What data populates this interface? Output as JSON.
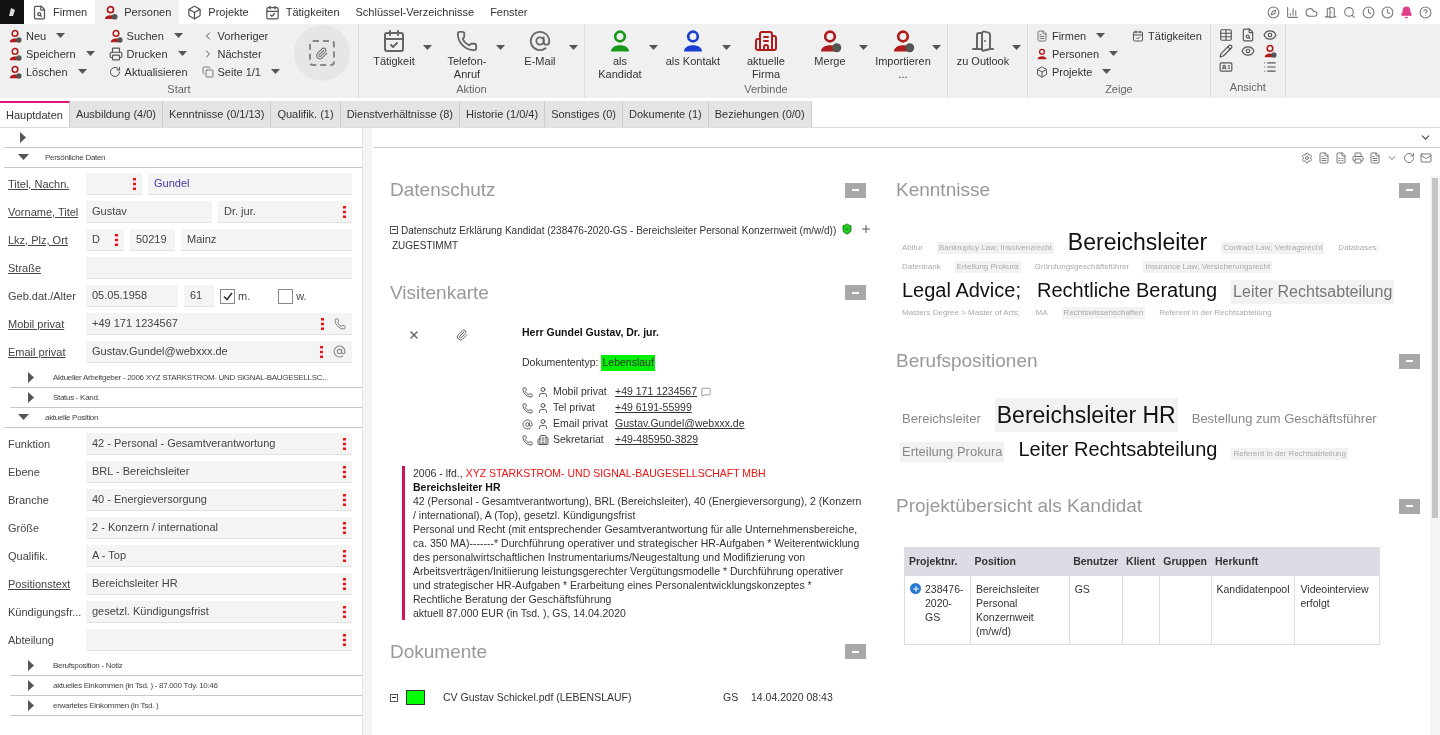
{
  "menu": [
    {
      "label": "Firmen",
      "kind": "icon",
      "selected": false
    },
    {
      "label": "Personen",
      "kind": "icon",
      "selected": true
    },
    {
      "label": "Projekte",
      "kind": "icon",
      "selected": false
    },
    {
      "label": "Tätigkeiten",
      "kind": "icon",
      "selected": false
    },
    {
      "label": "Schlüssel-Verzeichnisse",
      "kind": "plain",
      "selected": false
    },
    {
      "label": "Fenster",
      "kind": "plain",
      "selected": false
    }
  ],
  "ribbon": [
    {
      "kind": "start",
      "label": "Start",
      "columns": [
        [
          {
            "label": "Neu",
            "dropdown": true
          },
          {
            "label": "Speichern",
            "dropdown": true
          },
          {
            "label": "Löschen",
            "dropdown": true
          }
        ],
        [
          {
            "label": "Suchen",
            "dropdown": true
          },
          {
            "label": "Drucken",
            "dropdown": true
          },
          {
            "label": "Aktualisieren",
            "dropdown": false
          }
        ],
        [
          {
            "label": "Vorheriger",
            "dropdown": false
          },
          {
            "label": "Nächster",
            "dropdown": false
          },
          {
            "label": "Seite 1/1",
            "dropdown": true
          }
        ]
      ]
    },
    {
      "kind": "large",
      "label": "Aktion",
      "buttons": [
        {
          "label": "Tätigkeit",
          "dropdown": true
        },
        {
          "label": "Telefon-Anruf",
          "dropdown": true
        },
        {
          "label": "E-Mail",
          "dropdown": true
        }
      ]
    },
    {
      "kind": "large",
      "label": "Verbinde",
      "buttons": [
        {
          "label": "als Kandidat",
          "dropdown": true
        },
        {
          "label": "als Kontakt",
          "dropdown": true
        },
        {
          "label": "aktuelle Firma",
          "dropdown": false
        },
        {
          "label": "Merge",
          "dropdown": true
        },
        {
          "label": "Importieren...",
          "dropdown": true
        }
      ]
    },
    {
      "kind": "large",
      "buttons": [
        {
          "label": "zu Outlook",
          "dropdown": true
        }
      ]
    },
    {
      "kind": "small",
      "label": "Zeige",
      "columns": [
        [
          {
            "label": "Firmen",
            "dropdown": true
          },
          {
            "label": "Personen",
            "dropdown": true
          },
          {
            "label": "Projekte",
            "dropdown": true
          }
        ],
        [
          {
            "label": "Tätigkeiten",
            "dropdown": false
          }
        ]
      ]
    },
    {
      "kind": "icons",
      "label": "Ansicht"
    }
  ],
  "tabs": [
    {
      "label": "Hauptdaten",
      "selected": true
    },
    {
      "label": "Ausbildung (4/0)",
      "selected": false
    },
    {
      "label": "Kenntnisse (0/1/13)",
      "selected": false
    },
    {
      "label": "Qualifik. (1)",
      "selected": false
    },
    {
      "label": "Dienstverhältnisse (8)",
      "selected": false
    },
    {
      "label": "Historie (1/0/4)",
      "selected": false
    },
    {
      "label": "Sonstiges (0)",
      "selected": false
    },
    {
      "label": "Dokumente (1)",
      "selected": false
    },
    {
      "label": "Beziehungen (0/0)",
      "selected": false
    }
  ],
  "form": [
    {
      "expanded": false,
      "indented": false
    },
    {
      "title": "Persönliche Daten",
      "expanded": true,
      "indented": false,
      "rows": [
        {
          "label": "Titel, Nachn.",
          "link": true,
          "kind": "fields",
          "fields": [
            {
              "required": true
            },
            {
              "value": "Gundel",
              "required": false,
              "accent": true
            }
          ]
        },
        {
          "label": "Vorname, Titel",
          "link": true,
          "kind": "fields",
          "fields": [
            {
              "value": "Gustav",
              "required": false,
              "accent": false
            },
            {
              "value": "Dr. jur.",
              "required": true,
              "accent": false
            }
          ]
        },
        {
          "label": "Lkz, Plz, Ort",
          "link": true,
          "kind": "fields",
          "fields": [
            {
              "value": "D",
              "required": true,
              "accent": false
            },
            {
              "value": "50219",
              "required": false,
              "accent": false
            },
            {
              "value": "Mainz",
              "required": false,
              "accent": false
            }
          ]
        },
        {
          "label": "Straße",
          "link": true,
          "kind": "fields",
          "fields": [
            {
              "required": false
            }
          ]
        },
        {
          "label": "Geb.dat./Alter",
          "link": false,
          "kind": "birth",
          "fields": [
            {
              "value": "05.05.1958",
              "required": false,
              "accent": false
            },
            {
              "value": "61",
              "required": false,
              "accent": false
            }
          ],
          "options": [
            {
              "label": "m.",
              "checked": true
            },
            {
              "label": "w.",
              "checked": false
            }
          ]
        },
        {
          "label": "Mobil privat",
          "link": true,
          "kind": "phone",
          "fields": [
            {
              "value": "+49 171 1234567",
              "required": true,
              "accent": false
            }
          ]
        },
        {
          "label": "Email privat",
          "link": true,
          "kind": "email",
          "fields": [
            {
              "value": "Gustav.Gundel@webxxx.de",
              "required": true,
              "accent": false
            }
          ]
        }
      ]
    },
    {
      "title": "Aktueller Arbeitgeber - 2006 XYZ STARKSTROM- UND SIGNAL-BAUGESELLSC...",
      "expanded": false,
      "indented": true
    },
    {
      "title": "Status - Kand.",
      "expanded": false,
      "indented": true
    },
    {
      "title": "aktuelle Position",
      "expanded": true,
      "indented": false,
      "rows": [
        {
          "label": "Funktion",
          "link": false,
          "kind": "fields",
          "fields": [
            {
              "value": "42 - Personal - Gesamtverantwortung",
              "required": true,
              "accent": false
            }
          ]
        },
        {
          "label": "Ebene",
          "link": false,
          "kind": "fields",
          "fields": [
            {
              "value": "BRL - Bereichsleiter",
              "required": true,
              "accent": false
            }
          ]
        },
        {
          "label": "Branche",
          "link": false,
          "kind": "fields",
          "fields": [
            {
              "value": "40 - Energieversorgung",
              "required": true,
              "accent": false
            }
          ]
        },
        {
          "label": "Größe",
          "link": false,
          "kind": "fields",
          "fields": [
            {
              "value": "2 - Konzern / international",
              "required": true,
              "accent": false
            }
          ]
        },
        {
          "label": "Qualifik.",
          "link": false,
          "kind": "fields",
          "fields": [
            {
              "value": "A - Top",
              "required": true,
              "accent": false
            }
          ]
        },
        {
          "label": "Positionstext",
          "link": true,
          "kind": "fields",
          "fields": [
            {
              "value": "Bereichsleiter HR",
              "required": true,
              "accent": false
            }
          ]
        },
        {
          "label": "Kündigungsfr...",
          "link": false,
          "kind": "fields",
          "fields": [
            {
              "value": "gesetzl. Kündigungsfrist",
              "required": true,
              "accent": false
            }
          ]
        },
        {
          "label": "Abteilung",
          "link": false,
          "kind": "fields",
          "fields": [
            {
              "required": true
            }
          ]
        }
      ]
    },
    {
      "title": "Berufsposition - Notiz",
      "expanded": false,
      "indented": true
    },
    {
      "title": "aktuelles Einkommen (in Tsd. ) - 87.000 Tdy. 10:46",
      "expanded": false,
      "indented": true
    },
    {
      "title": "erwartetes Einkommen (in Tsd. )",
      "expanded": false,
      "indented": true
    }
  ],
  "datenschutz": {
    "title": "Datenschutz",
    "entry": "Datenschutz Erklärung Kandidat (238476-2020-GS - Bereichsleiter Personal Konzernweit (m/w/d))",
    "status": "ZUGESTIMMT"
  },
  "visitenkarte": {
    "title": "Visitenkarte",
    "name": "Herr Gundel Gustav, Dr. jur.",
    "doctype_label": "Dokumententyp:",
    "doctype": "Lebenslauf",
    "contacts": [
      {
        "kind": "mobile",
        "label": "Mobil privat",
        "value": "+49 171 1234567"
      },
      {
        "kind": "phone",
        "label": "Tel privat",
        "value": "+49 6191-55999"
      },
      {
        "kind": "email",
        "label": "Email privat",
        "value": "Gustav.Gundel@webxxx.de"
      },
      {
        "kind": "office",
        "label": "Sekretariat",
        "value": "+49-485950-3829"
      }
    ],
    "position": {
      "period": "2006 - lfd.,",
      "company": "XYZ STARKSTROM- UND SIGNAL-BAUGESELLSCHAFT MBH",
      "title": "Bereichsleiter HR",
      "summary": "42 (Personal - Gesamtverantwortung), BRL (Bereichsleiter), 40 (Energieversorgung), 2 (Konzern / international), A (Top), gesetzl. Kündigungsfrist",
      "description": "Personal und Recht (mit entsprechender Gesamtverantwortung für alle Unternehmensbereiche, ca. 350 MA)-------* Durchführung operativer und strategischer HR-Aufgaben * Weiterentwicklung des personalwirtschaftlichen Instrumentariums/Neugestaltung und Modifizierung von Arbeitsverträgen/Initiierung leistungsgerechter Vergütungsmodelle * Durchführung operativer und strategischer HR-Aufgaben * Erarbeitung eines Personalentwicklungskonzeptes * Rechtliche Beratung der Geschäftsführung",
      "salary": "aktuell 87.000 EUR (in Tsd. ), GS, 14.04.2020"
    }
  },
  "dokumente": {
    "title": "Dokumente",
    "items": [
      {
        "color": "#00ff00",
        "name": "CV Gustav Schickel.pdf (LEBENSLAUF)",
        "user": "GS",
        "date": "14.04.2020 08:43"
      }
    ]
  },
  "kenntnisse": {
    "title": "Kenntnisse",
    "tags": [
      {
        "text": "Abitur",
        "kind": "tiny",
        "shaded": false
      },
      {
        "text": "Bankruptcy Law; Insolvenzrecht",
        "kind": "tiny",
        "shaded": true
      },
      {
        "text": "Bereichsleiter",
        "kind": "huge",
        "shaded": false
      },
      {
        "text": "Contract Law; Vertragsrecht",
        "kind": "tiny",
        "shaded": true
      },
      {
        "text": "Databases;",
        "kind": "tiny",
        "shaded": false
      },
      {
        "text": "Datenbank",
        "kind": "tiny",
        "shaded": false
      },
      {
        "text": "Erteilung Prokura",
        "kind": "tiny",
        "shaded": true
      },
      {
        "text": "Gründungsgeschäftsführer",
        "kind": "tiny",
        "shaded": false
      },
      {
        "text": "Insurance Law; Versicherungsrecht",
        "kind": "tiny",
        "shaded": true
      },
      {
        "text": "Legal Advice;",
        "kind": "large",
        "shaded": false
      },
      {
        "text": "Rechtliche Beratung",
        "kind": "large",
        "shaded": false
      },
      {
        "text": "Leiter Rechtsabteilung",
        "kind": "medium",
        "shaded": true
      },
      {
        "text": "Masters Degree > Master of Arts;",
        "kind": "tiny",
        "shaded": false
      },
      {
        "text": "MA",
        "kind": "tiny",
        "shaded": false
      },
      {
        "text": "Rechtswissenschaften",
        "kind": "tiny",
        "shaded": true
      },
      {
        "text": "Referent in der Rechtsabteilung",
        "kind": "tiny",
        "shaded": false
      }
    ]
  },
  "berufspositionen": {
    "title": "Berufspositionen",
    "tags": [
      {
        "text": "Bereichsleiter",
        "kind": "small",
        "shaded": false
      },
      {
        "text": "Bereichsleiter HR",
        "kind": "huge",
        "shaded": true
      },
      {
        "text": "Bestellung zum Geschäftsführer",
        "kind": "small",
        "shaded": false
      },
      {
        "text": "Erteilung Prokura",
        "kind": "small",
        "shaded": true
      },
      {
        "text": "Leiter Rechtsabteilung",
        "kind": "large",
        "shaded": false
      },
      {
        "text": "Referent in der Rechtsabteilung",
        "kind": "tiny",
        "shaded": true
      }
    ]
  },
  "projekte": {
    "title": "Projektübersicht als Kandidat",
    "columns": [
      "Projektnr.",
      "Position",
      "Benutzer",
      "Klient",
      "Gruppen",
      "Herkunft",
      ""
    ],
    "rows": [
      {
        "cells": [
          {
            "text": "238476-2020-GS",
            "kind": "project"
          },
          {
            "text": "Bereichsleiter Personal Konzernweit (m/w/d)"
          },
          {
            "text": "GS"
          },
          {},
          {},
          {
            "text": "Kandidatenpool"
          },
          {
            "text": "Videointerview erfolgt"
          }
        ]
      }
    ]
  }
}
